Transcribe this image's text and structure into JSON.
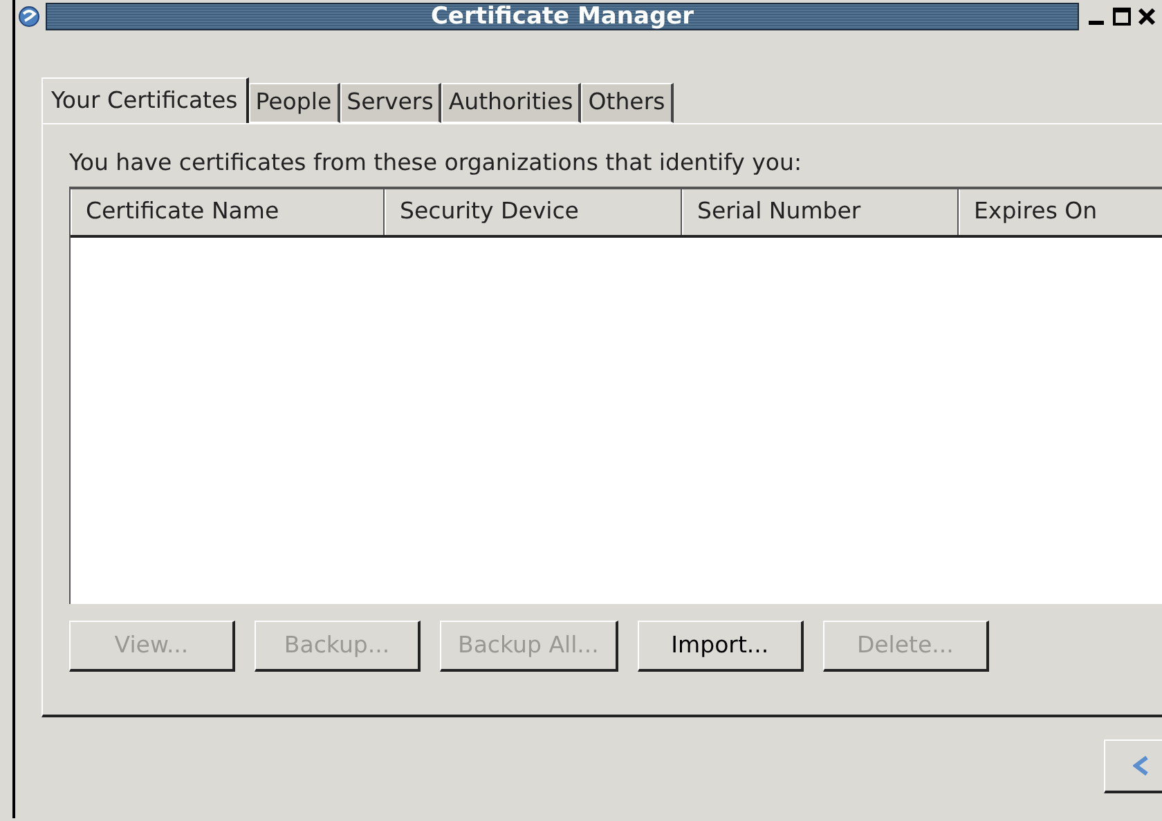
{
  "window": {
    "title": "Certificate Manager"
  },
  "tabs": [
    {
      "label": "Your Certificates",
      "selected": true
    },
    {
      "label": "People",
      "selected": false
    },
    {
      "label": "Servers",
      "selected": false
    },
    {
      "label": "Authorities",
      "selected": false
    },
    {
      "label": "Others",
      "selected": false
    }
  ],
  "description": "You have certificates from these organizations that identify you:",
  "table": {
    "columns": [
      "Certificate Name",
      "Security Device",
      "Serial Number",
      "Expires On"
    ]
  },
  "buttons": [
    {
      "label": "View...",
      "disabled": true
    },
    {
      "label": "Backup...",
      "disabled": true
    },
    {
      "label": "Backup All...",
      "disabled": true
    },
    {
      "label": "Import...",
      "disabled": false
    },
    {
      "label": "Delete...",
      "disabled": true
    }
  ]
}
